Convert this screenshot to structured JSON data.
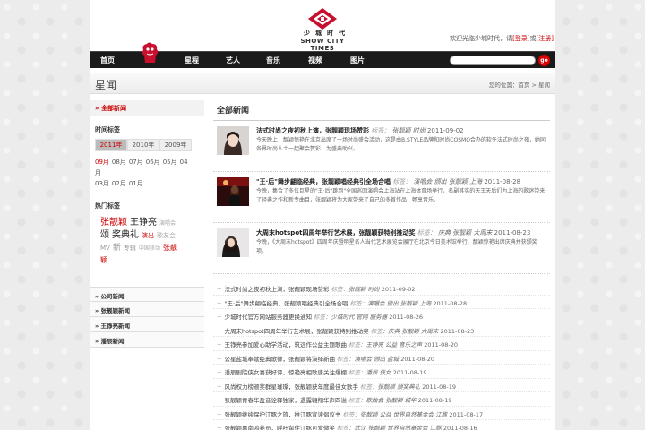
{
  "header": {
    "logo_cn": "少城时代",
    "logo_en": "SHOW CITY TIMES",
    "welcome_prefix": "欢迎光临少城时代，请",
    "login": "[登录]",
    "or": "或",
    "register": "[注册]"
  },
  "nav": {
    "items": [
      "首页",
      "星程",
      "艺人",
      "音乐",
      "视频",
      "图片"
    ],
    "search_button": "go"
  },
  "titlebar": {
    "title": "星闻",
    "breadcrumb": "您的位置：首页 > 星闻"
  },
  "sidebar": {
    "all_news": "» 全部新闻",
    "time_label": "时间标签",
    "years": [
      "2011年",
      "2010年",
      "2009年"
    ],
    "months": [
      "09月",
      "08月",
      "07月",
      "06月",
      "05月",
      "04月",
      "03月",
      "02月",
      "01月"
    ],
    "hot_label": "热门标签",
    "tags": [
      {
        "text": "张靓颖",
        "color": "#c00",
        "size": 10
      },
      {
        "text": "王铮亮",
        "color": "#222",
        "size": 10
      },
      {
        "text": "演唱会",
        "color": "#aaa",
        "size": 6
      },
      {
        "text": "颂",
        "color": "#222",
        "size": 10
      },
      {
        "text": "奖典礼",
        "color": "#222",
        "size": 10
      },
      {
        "text": "演出",
        "color": "#c00",
        "size": 7
      },
      {
        "text": "歌友会",
        "color": "#aaa",
        "size": 7
      },
      {
        "text": "MV",
        "color": "#999",
        "size": 7
      },
      {
        "text": "新",
        "color": "#999",
        "size": 9
      },
      {
        "text": "专辑",
        "color": "#999",
        "size": 7
      },
      {
        "text": "中国移动",
        "color": "#aaa",
        "size": 6
      },
      {
        "text": "张靓颖",
        "color": "#c00",
        "size": 8
      }
    ],
    "sections": [
      "» 公司新闻",
      "» 张靓颖新闻",
      "» 王铮亮新闻",
      "» 潘辰新闻"
    ]
  },
  "main": {
    "heading": "全部新闻",
    "featured": [
      {
        "title": "法式时尚之夜初秋上演，张靓颖现场赞彩",
        "keyword_label": "标签：",
        "tags": "张靓颖 时尚",
        "date": "2011-09-02",
        "desc": "今天晚上，靓颖惊艳在北京出席了一场时尚盛会活动，这是由B.STYLE品牌和时尚COSMO合办的软冬法式时尚之夜，她同各界时尚人士一起聚会赞彩，为盛典助兴。"
      },
      {
        "title": "\"王·后\"舞步翩临经典，张靓颖唱经典引全场合唱",
        "keyword_label": "标签：",
        "tags": "演唱会 颁出 张靓颖 上海",
        "date": "2011-08-28",
        "desc": "今晚，集合了多位巨星的\"王·后\"跳到\"全国巡回演唱会上海站在上海体育场举行，名副其实的天王天后们为上海的歌迷带来了经典之作和新专曲目，张靓颖将为大家带来了自己的多首作品，畅享音乐。"
      },
      {
        "title": "大周末hotspot四周年举行艺术展，张靓颖获特别推动奖",
        "keyword_label": "标签：",
        "tags": "庆典 张靓颖 大周末",
        "date": "2011-08-23",
        "desc": "今晚，《大周末hotspot》四周年庆暨明星名人当代艺术展览会展厅在北京今日美术馆举行，靓颖惊艳出席庆典并获颁奖项。"
      }
    ],
    "list": [
      {
        "title": "法式时尚之夜初秋上演，张靓颖现场赞彩",
        "tags": "张靓颖 时尚",
        "date": "2011-09-02"
      },
      {
        "title": "\"王·后\"舞步翩临经典，张靓颖唱经典引全场合唱",
        "tags": "演唱会 颁出 张靓颖 上海",
        "date": "2011-08-28"
      },
      {
        "title": "少城时代官方网站服务器更换通知",
        "tags": "少城时代 官网 服务器",
        "date": "2011-08-26"
      },
      {
        "title": "大周末hotspot四周年举行艺术展，张靓颖获特别推动奖",
        "tags": "庆典 张靓颖 大周末",
        "date": "2011-08-23"
      },
      {
        "title": "王铮亮参加爱心助学活动，筑远作公益主题歌曲",
        "tags": "王铮亮 公益 音乐之声",
        "date": "2011-08-20"
      },
      {
        "title": "公星盐城奉献经典歌律，张靓颖将演绎新曲",
        "tags": "演唱会 颁出 盐城",
        "date": "2011-08-20"
      },
      {
        "title": "潘辰剧院侠女喜获好评，惊艳亮相歌唐关注爆棚",
        "tags": "潘辰 侠女",
        "date": "2011-08-19"
      },
      {
        "title": "风尚权力榜颁奖群星璀璨，张靓颖获年度最佳女歌手",
        "tags": "张靓颖 颁奖典礼",
        "date": "2011-08-19"
      },
      {
        "title": "张靓颖青春华盈音诠释独家，遇露翱翔华声四溢",
        "tags": "歌曲会 张靓颖 城华",
        "date": "2011-08-19"
      },
      {
        "title": "张靓颖继续保护江豚之旅，推江豚宣读倡议书",
        "tags": "张靓颖 公益 世界自然基金会 江豚",
        "date": "2011-08-17"
      },
      {
        "title": "张靓颖嘉南鸿养员，呼吁留住江豚可爱微笑",
        "tags": "武汉 张靓颖 世界自然基金会 江豚",
        "date": "2011-08-16"
      }
    ]
  }
}
